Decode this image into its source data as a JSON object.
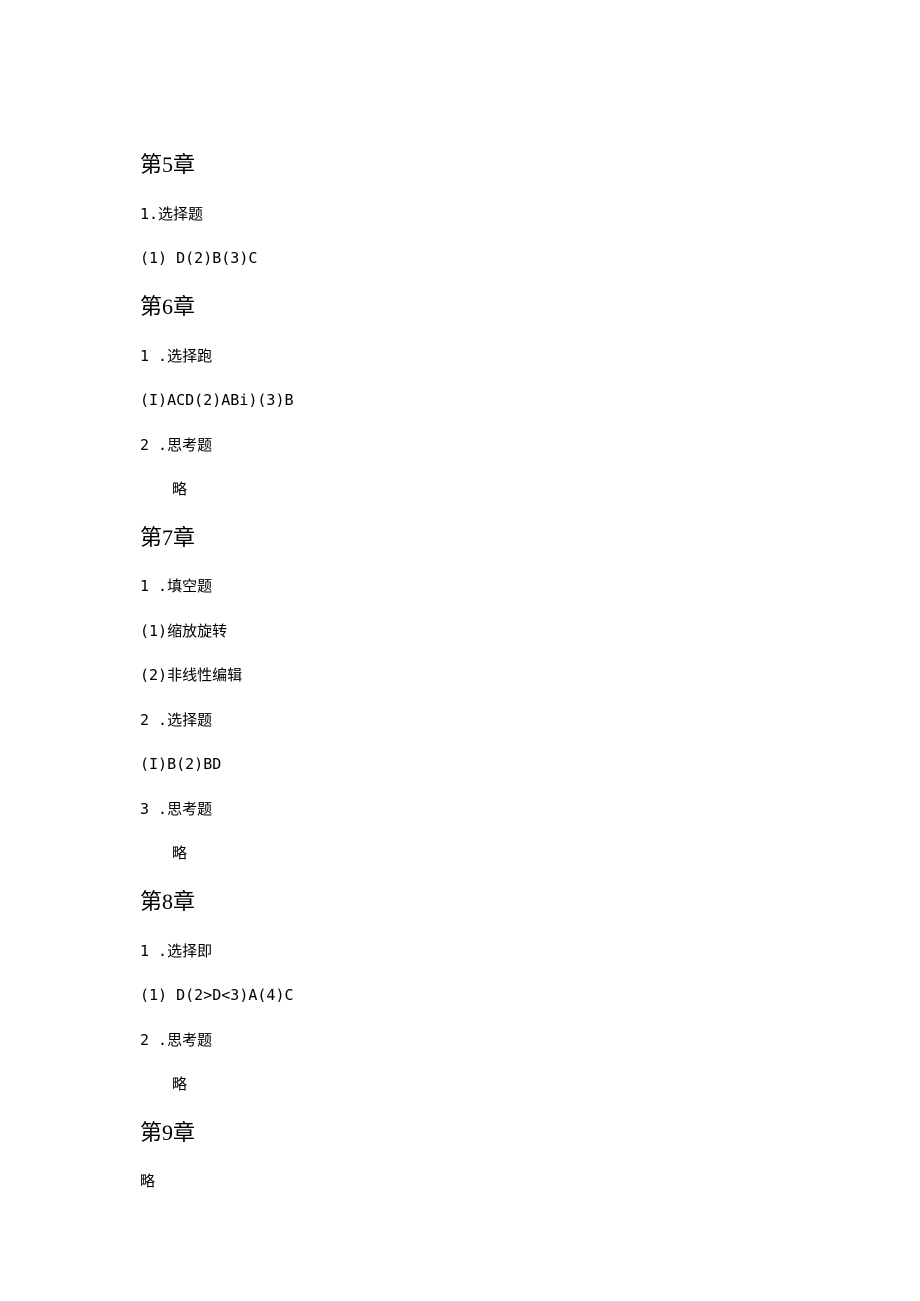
{
  "ch5": {
    "title": "第5章",
    "q1_label": "1.选择题",
    "q1_ans": "(1) D(2)B(3)C"
  },
  "ch6": {
    "title": "第6章",
    "q1_label": "1 .选择跑",
    "q1_ans": "(I)ACD(2)ABi)(3)B",
    "q2_label": "2 .思考题",
    "q2_ans": "略"
  },
  "ch7": {
    "title": "第7章",
    "q1_label": "1 .填空题",
    "q1_a1": "(1)缩放旋转",
    "q1_a2": "(2)非线性编辑",
    "q2_label": "2 .选择题",
    "q2_ans": "(I)B(2)BD",
    "q3_label": "3 .思考题",
    "q3_ans": "略"
  },
  "ch8": {
    "title": "第8章",
    "q1_label": "1 .选择即",
    "q1_ans": "(1) D(2>D<3)A(4)C",
    "q2_label": "2 .思考题",
    "q2_ans": "略"
  },
  "ch9": {
    "title": "第9章",
    "body": "略"
  }
}
